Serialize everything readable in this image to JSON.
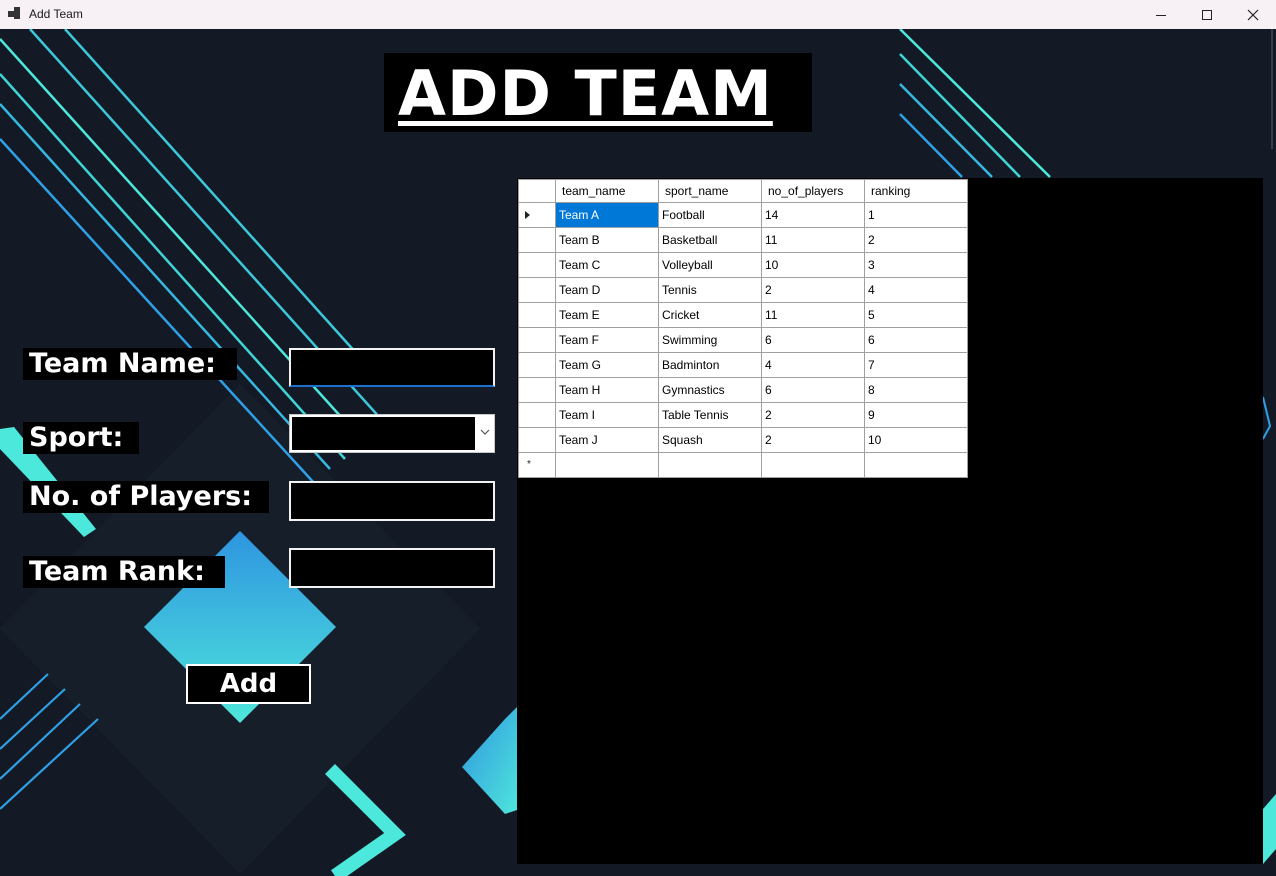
{
  "window": {
    "title": "Add Team"
  },
  "heading": "ADD TEAM",
  "form": {
    "team_name_label": "Team Name:",
    "sport_label": "Sport:",
    "players_label": "No. of Players:",
    "rank_label": "Team Rank:",
    "team_name_value": "",
    "sport_value": "",
    "players_value": "",
    "rank_value": "",
    "add_button": "Add"
  },
  "grid": {
    "columns": [
      "team_name",
      "sport_name",
      "no_of_players",
      "ranking"
    ],
    "rows": [
      [
        "Team A",
        "Football",
        "14",
        "1"
      ],
      [
        "Team B",
        "Basketball",
        "11",
        "2"
      ],
      [
        "Team C",
        "Volleyball",
        "10",
        "3"
      ],
      [
        "Team D",
        "Tennis",
        "2",
        "4"
      ],
      [
        "Team E",
        "Cricket",
        "11",
        "5"
      ],
      [
        "Team F",
        "Swimming",
        "6",
        "6"
      ],
      [
        "Team G",
        "Badminton",
        "4",
        "7"
      ],
      [
        "Team H",
        "Gymnastics",
        "6",
        "8"
      ],
      [
        "Team I",
        "Table Tennis",
        "2",
        "9"
      ],
      [
        "Team J",
        "Squash",
        "2",
        "10"
      ]
    ],
    "selected_row": 0,
    "new_row_marker": "*"
  },
  "colors": {
    "background": "#131a25",
    "accent_cyan": "#4de8dc",
    "accent_blue": "#2e9fe0",
    "selection": "#0078d7"
  }
}
